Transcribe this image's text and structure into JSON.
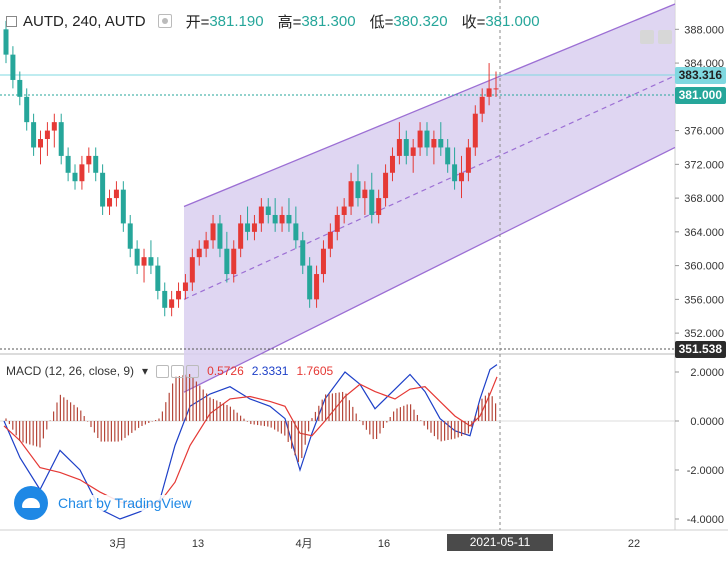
{
  "header": {
    "symbol": "AUTD",
    "interval": "240",
    "exchange": "AUTD",
    "open_label": "开=",
    "open": "381.190",
    "high_label": "高=",
    "high": "381.300",
    "low_label": "低=",
    "low": "380.320",
    "close_label": "收=",
    "close": "381.000"
  },
  "price_axis": {
    "ticks": [
      "388.000",
      "384.000",
      "380.000",
      "376.000",
      "372.000",
      "368.000",
      "364.000",
      "360.000",
      "356.000",
      "352.000"
    ],
    "label_upper": "383.316",
    "label_last": "381.000",
    "label_lower": "351.538"
  },
  "time_axis": {
    "ticks": [
      "3月",
      "13",
      "4月",
      "16",
      "22"
    ],
    "crosshair_date": "2021-05-11 04:00:00"
  },
  "macd": {
    "title": "MACD (12, 26, close, 9)",
    "histogram": "0.5726",
    "macd": "2.3331",
    "signal": "1.7605",
    "ticks": [
      "2.0000",
      "0.0000",
      "-2.0000",
      "-4.0000"
    ]
  },
  "branding": {
    "text": "Chart by TradingView"
  },
  "colors": {
    "up": "#e53935",
    "down": "#26a69a",
    "channel_fill": "#d9cff0",
    "channel_line": "#9c6fd4",
    "macd_line": "#1e40c8",
    "signal_line": "#e53935",
    "hist": "#b5473a",
    "last_price": "#26a69a",
    "ref_price": "#7fd8e0"
  },
  "chart_data": {
    "type": "candlestick",
    "y_range": [
      350,
      391
    ],
    "candles": [
      [
        388,
        389,
        384,
        385
      ],
      [
        385,
        386,
        381,
        382
      ],
      [
        382,
        383,
        379,
        380
      ],
      [
        380,
        381,
        376,
        377
      ],
      [
        377,
        378,
        373,
        374
      ],
      [
        374,
        376,
        372,
        375
      ],
      [
        375,
        377,
        373,
        376
      ],
      [
        376,
        378,
        374,
        377
      ],
      [
        377,
        378,
        372,
        373
      ],
      [
        373,
        374,
        370,
        371
      ],
      [
        371,
        372,
        369,
        370
      ],
      [
        370,
        373,
        369,
        372
      ],
      [
        372,
        374,
        371,
        373
      ],
      [
        373,
        374,
        370,
        371
      ],
      [
        371,
        372,
        366,
        367
      ],
      [
        367,
        369,
        366,
        368
      ],
      [
        368,
        370,
        367,
        369
      ],
      [
        369,
        370,
        364,
        365
      ],
      [
        365,
        366,
        361,
        362
      ],
      [
        362,
        363,
        359,
        360
      ],
      [
        360,
        362,
        358,
        361
      ],
      [
        361,
        363,
        359,
        360
      ],
      [
        360,
        361,
        356,
        357
      ],
      [
        357,
        358,
        354,
        355
      ],
      [
        355,
        357,
        354,
        356
      ],
      [
        356,
        358,
        355,
        357
      ],
      [
        357,
        359,
        356,
        358
      ],
      [
        358,
        362,
        357,
        361
      ],
      [
        361,
        363,
        360,
        362
      ],
      [
        362,
        364,
        361,
        363
      ],
      [
        363,
        366,
        362,
        365
      ],
      [
        365,
        366,
        361,
        362
      ],
      [
        362,
        364,
        358,
        359
      ],
      [
        359,
        363,
        358,
        362
      ],
      [
        362,
        366,
        361,
        365
      ],
      [
        365,
        367,
        363,
        364
      ],
      [
        364,
        366,
        363,
        365
      ],
      [
        365,
        368,
        364,
        367
      ],
      [
        367,
        368,
        365,
        366
      ],
      [
        366,
        368,
        364,
        365
      ],
      [
        365,
        367,
        364,
        366
      ],
      [
        366,
        368,
        364,
        365
      ],
      [
        365,
        367,
        362,
        363
      ],
      [
        363,
        364,
        359,
        360
      ],
      [
        360,
        361,
        355,
        356
      ],
      [
        356,
        360,
        355,
        359
      ],
      [
        359,
        363,
        358,
        362
      ],
      [
        362,
        365,
        361,
        364
      ],
      [
        364,
        367,
        363,
        366
      ],
      [
        366,
        368,
        365,
        367
      ],
      [
        367,
        371,
        366,
        370
      ],
      [
        370,
        372,
        367,
        368
      ],
      [
        368,
        370,
        366,
        369
      ],
      [
        369,
        371,
        365,
        366
      ],
      [
        366,
        369,
        365,
        368
      ],
      [
        368,
        372,
        367,
        371
      ],
      [
        371,
        374,
        370,
        373
      ],
      [
        373,
        377,
        372,
        375
      ],
      [
        375,
        376,
        372,
        373
      ],
      [
        373,
        375,
        371,
        374
      ],
      [
        374,
        377,
        373,
        376
      ],
      [
        376,
        377,
        373,
        374
      ],
      [
        374,
        376,
        372,
        375
      ],
      [
        375,
        377,
        373,
        374
      ],
      [
        374,
        375,
        371,
        372
      ],
      [
        372,
        374,
        369,
        370
      ],
      [
        370,
        373,
        368,
        371
      ],
      [
        371,
        375,
        370,
        374
      ],
      [
        374,
        379,
        373,
        378
      ],
      [
        378,
        381,
        377,
        380
      ],
      [
        380,
        384,
        379,
        381
      ],
      [
        381,
        383,
        380,
        381
      ]
    ],
    "channel": {
      "upper": [
        367,
        391
      ],
      "lower": [
        345,
        374
      ]
    }
  }
}
